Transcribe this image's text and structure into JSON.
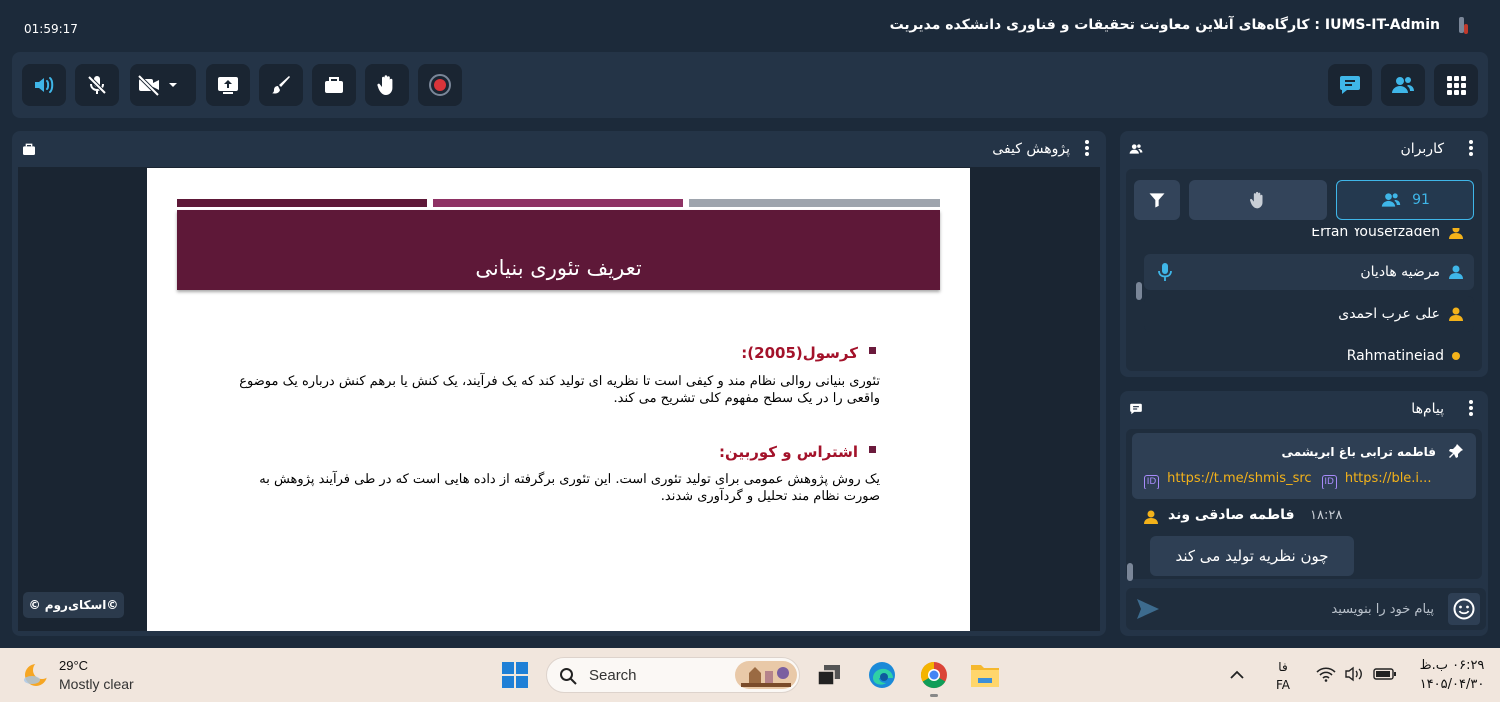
{
  "header": {
    "timer": "01:59:17",
    "room_title": "IUMS-IT-Admin : کارگاه‌های آنلاین معاونت تحقیقات و فناوری دانشکده مدیریت"
  },
  "toolbar": {
    "accent": "#3fb6e8",
    "buttons": [
      "speaker-icon",
      "mic-off-icon",
      "camera-off-icon",
      "share-screen-icon",
      "whiteboard-icon",
      "files-icon",
      "raise-hand-icon",
      "record-icon",
      "chat-icon",
      "users-icon",
      "apps-grid-icon"
    ]
  },
  "presentation": {
    "title": "پژوهش کیفی",
    "watermark": "©اسکای‌روم ©",
    "slide": {
      "heading": "تعریف تئوری بنیانی",
      "sections": [
        {
          "head": "کرسول(2005):",
          "body": "تئوری بنیانی روالی نظام مند و کیفی است تا نظریه ای تولید کند که یک فرآیند، یک کنش یا برهم کنش درباره یک موضوع واقعی را در یک سطح مفهوم کلی تشریح می کند."
        },
        {
          "head": "اشتراس و کوربین:",
          "body": "یک روش پژوهش عمومی برای تولید تئوری است. این تئوری برگرفته از داده هایی است که در طی فرآیند پژوهش به صورت نظام مند تحلیل و گردآوری شدند."
        }
      ]
    }
  },
  "users_panel": {
    "title": "کاربران",
    "count": "91",
    "users": [
      {
        "name": "Erfan Yousefzadeh",
        "status_color": "#f3b21a"
      },
      {
        "name": "مرضیه هادیان",
        "status_color": "#3fb6e8",
        "mic": true
      },
      {
        "name": "علی عرب احمدی",
        "status_color": "#f3b21a"
      },
      {
        "name": "Rahmatinejad",
        "status_color": "#f3b21a"
      }
    ]
  },
  "messages_panel": {
    "title": "پیام‌ها",
    "pinned": {
      "author": "فاطمه ترابی باغ ابریشمی",
      "links": [
        "https://t.me/shmis_src",
        "https://ble.i..."
      ]
    },
    "message": {
      "author": "فاطمه صادقی وند",
      "time": "۱۸:۲۸",
      "text": "چون نظریه تولید می کند"
    },
    "input_placeholder": "پیام خود را بنویسید"
  },
  "taskbar": {
    "weather_temp": "29°C",
    "weather_desc": "Mostly clear",
    "search_label": "Search",
    "lang_top": "فا",
    "lang_bottom": "FA",
    "clock_time": "۰۶:۲۹ ب.ظ",
    "clock_date": "۱۴۰۵/۰۴/۳۰"
  }
}
